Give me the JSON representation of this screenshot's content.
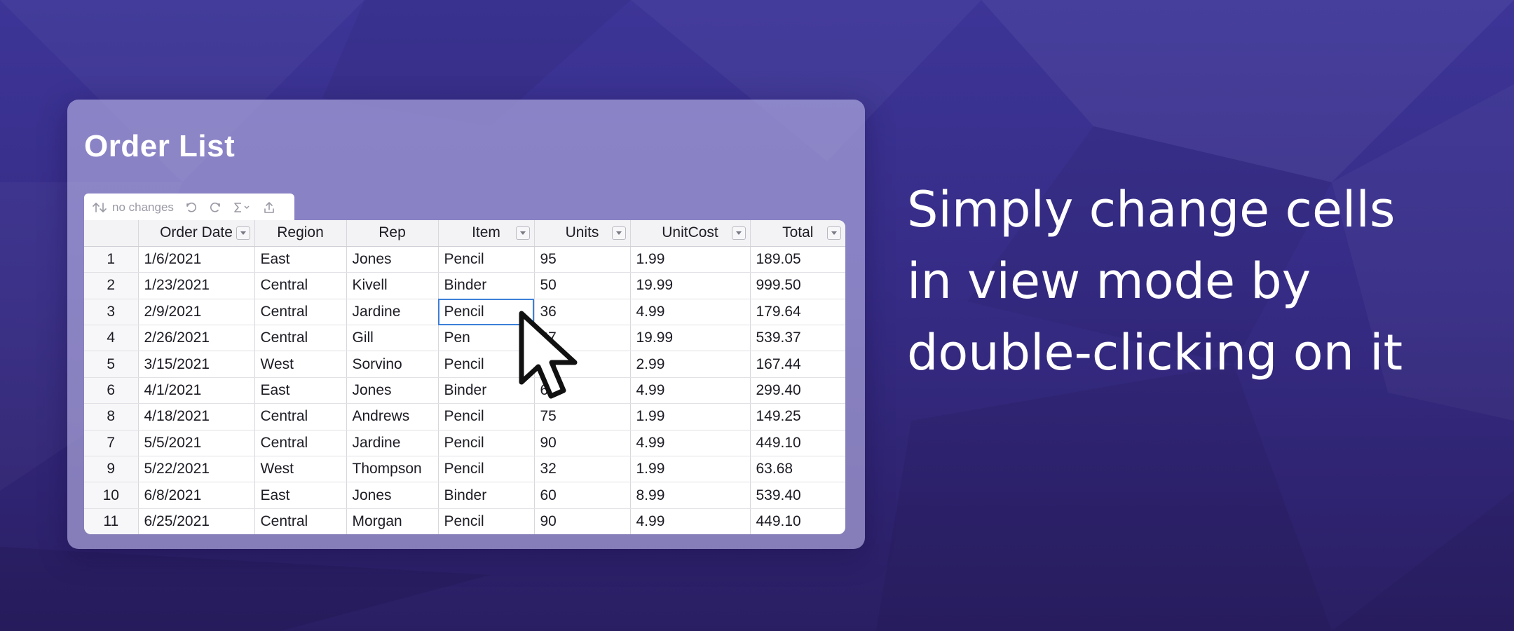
{
  "panel": {
    "title": "Order List"
  },
  "toolbar": {
    "sort_icon": "sort-arrows-icon",
    "status": "no changes",
    "undo_icon": "undo-icon",
    "redo_icon": "redo-icon",
    "aggregate_icon": "sigma-icon",
    "export_icon": "export-icon"
  },
  "columns": [
    "",
    "Order Date",
    "Region",
    "Rep",
    "Item",
    "Units",
    "UnitCost",
    "Total"
  ],
  "rows": [
    [
      "1",
      "1/6/2021",
      "East",
      "Jones",
      "Pencil",
      "95",
      "1.99",
      "189.05"
    ],
    [
      "2",
      "1/23/2021",
      "Central",
      "Kivell",
      "Binder",
      "50",
      "19.99",
      "999.50"
    ],
    [
      "3",
      "2/9/2021",
      "Central",
      "Jardine",
      "Pencil",
      "36",
      "4.99",
      "179.64"
    ],
    [
      "4",
      "2/26/2021",
      "Central",
      "Gill",
      "Pen",
      "27",
      "19.99",
      "539.37"
    ],
    [
      "5",
      "3/15/2021",
      "West",
      "Sorvino",
      "Pencil",
      "56",
      "2.99",
      "167.44"
    ],
    [
      "6",
      "4/1/2021",
      "East",
      "Jones",
      "Binder",
      "60",
      "4.99",
      "299.40"
    ],
    [
      "8",
      "4/18/2021",
      "Central",
      "Andrews",
      "Pencil",
      "75",
      "1.99",
      "149.25"
    ],
    [
      "7",
      "5/5/2021",
      "Central",
      "Jardine",
      "Pencil",
      "90",
      "4.99",
      "449.10"
    ],
    [
      "9",
      "5/22/2021",
      "West",
      "Thompson",
      "Pencil",
      "32",
      "1.99",
      "63.68"
    ],
    [
      "10",
      "6/8/2021",
      "East",
      "Jones",
      "Binder",
      "60",
      "8.99",
      "539.40"
    ],
    [
      "11",
      "6/25/2021",
      "Central",
      "Morgan",
      "Pencil",
      "90",
      "4.99",
      "449.10"
    ]
  ],
  "selected_cell": {
    "row": 2,
    "col": 4
  },
  "tagline": [
    "Simply change cells",
    "in view mode by",
    "double-clicking on it"
  ],
  "colors": {
    "background": "#362c86",
    "selection": "#3d7fd9",
    "panel": "#bcb6e8"
  }
}
